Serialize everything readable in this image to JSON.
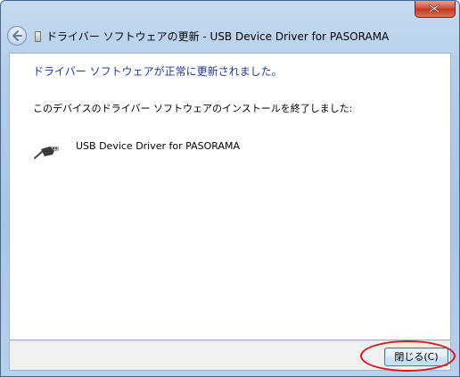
{
  "window": {
    "title": "ドライバー ソフトウェアの更新 - USB Device Driver for PASORAMA"
  },
  "main": {
    "heading": "ドライバー ソフトウェアが正常に更新されました。",
    "description": "このデバイスのドライバー ソフトウェアのインストールを終了しました:",
    "device_name": "USB Device Driver for PASORAMA",
    "device_icon": "usb-connector-icon"
  },
  "footer": {
    "close_label": "閉じる(C)"
  },
  "colors": {
    "heading": "#1f3a99",
    "annotation": "#e0141c"
  }
}
